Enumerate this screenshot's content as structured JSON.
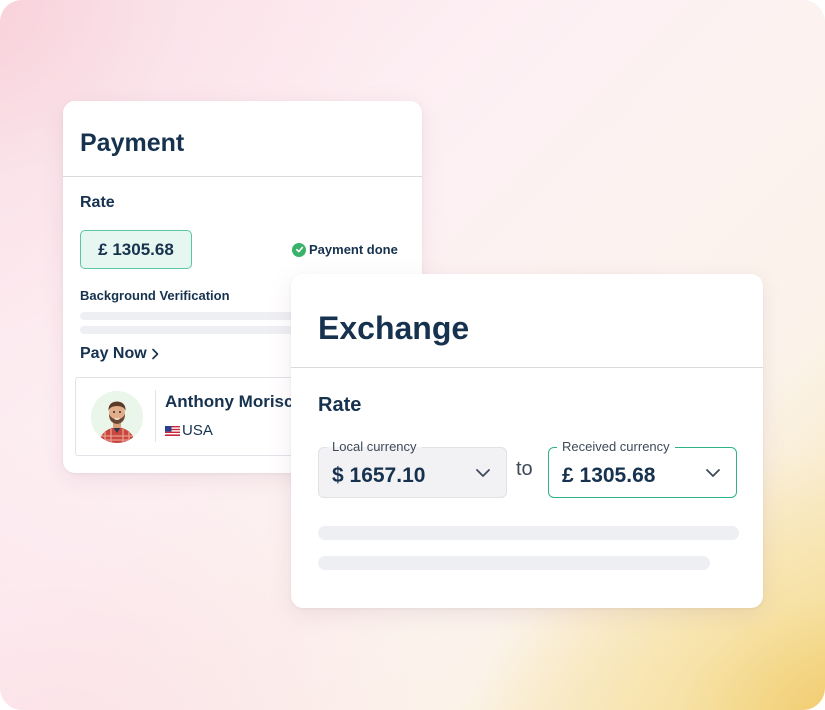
{
  "payment": {
    "title": "Payment",
    "rate_label": "Rate",
    "rate_value": "£ 1305.68",
    "status": "Payment done",
    "background_verification_label": "Background Verification",
    "pay_now_label": "Pay Now",
    "user": {
      "name": "Anthony Morisc",
      "country": "USA",
      "country_flag": "us-flag-icon"
    }
  },
  "exchange": {
    "title": "Exchange",
    "rate_label": "Rate",
    "local_currency": {
      "label": "Local currency",
      "value": "$ 1657.10"
    },
    "connector": "to",
    "received_currency": {
      "label": "Received currency",
      "value": "£ 1305.68"
    }
  },
  "colors": {
    "heading": "#16324f",
    "accent_green": "#2fb383",
    "chip_bg": "#e6f6f0",
    "status_check": "#3bb26a"
  }
}
